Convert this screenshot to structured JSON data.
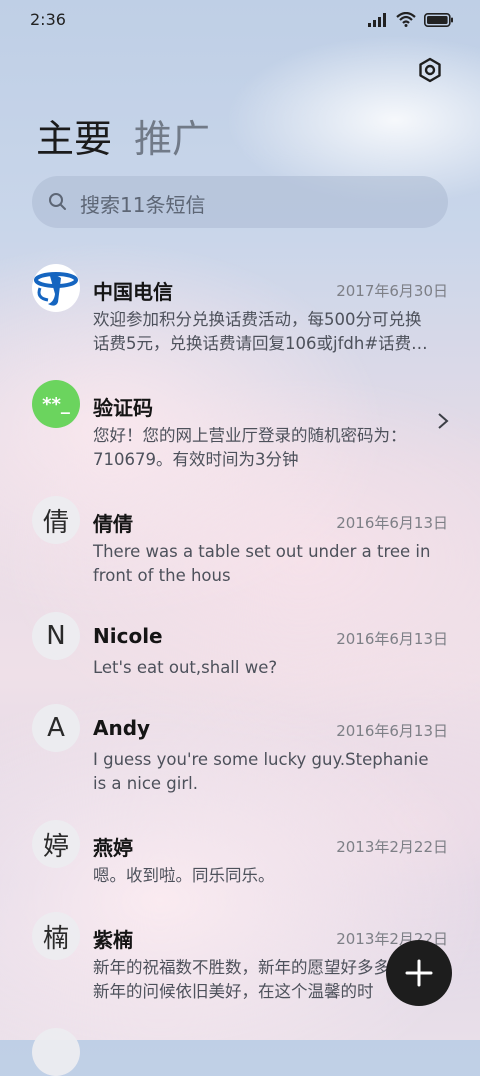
{
  "status_bar": {
    "time": "2:36"
  },
  "header": {
    "tab_primary": "主要",
    "tab_promotions": "推广"
  },
  "search": {
    "placeholder": "搜索11条短信"
  },
  "messages": [
    {
      "avatar_text": "",
      "name": "中国电信",
      "date": "2017年6月30日",
      "line1": "欢迎参加积分兑换话费活动，每500分可兑换",
      "line2": "话费5元，兑换话费请回复106或jfdh#话费…"
    },
    {
      "avatar_text": "**_",
      "name": "验证码",
      "date": "",
      "line1": "您好！您的网上营业厅登录的随机密码为：",
      "line2": "710679。有效时间为3分钟"
    },
    {
      "avatar_text": "倩",
      "name": "倩倩",
      "date": "2016年6月13日",
      "line1": "There was a table set out under a tree in",
      "line2": "front of the hous"
    },
    {
      "avatar_text": "N",
      "name": "Nicole",
      "date": "2016年6月13日",
      "line1": "Let's eat out,shall we?",
      "line2": ""
    },
    {
      "avatar_text": "A",
      "name": "Andy",
      "date": "2016年6月13日",
      "line1": "I guess you're some lucky guy.Stephanie",
      "line2": "is a nice girl."
    },
    {
      "avatar_text": "婷",
      "name": "燕婷",
      "date": "2013年2月22日",
      "line1": "嗯。收到啦。同乐同乐。",
      "line2": ""
    },
    {
      "avatar_text": "楠",
      "name": "紫楠",
      "date": "2013年2月22日",
      "line1": "新年的祝福数不胜数，新年的愿望好多多，",
      "line2": "新年的问候依旧美好，在这个温馨的时"
    }
  ],
  "colors": {
    "telecom_blue": "#1565c0",
    "verify_green": "#6bd45e",
    "fab": "#1d1d1d"
  }
}
